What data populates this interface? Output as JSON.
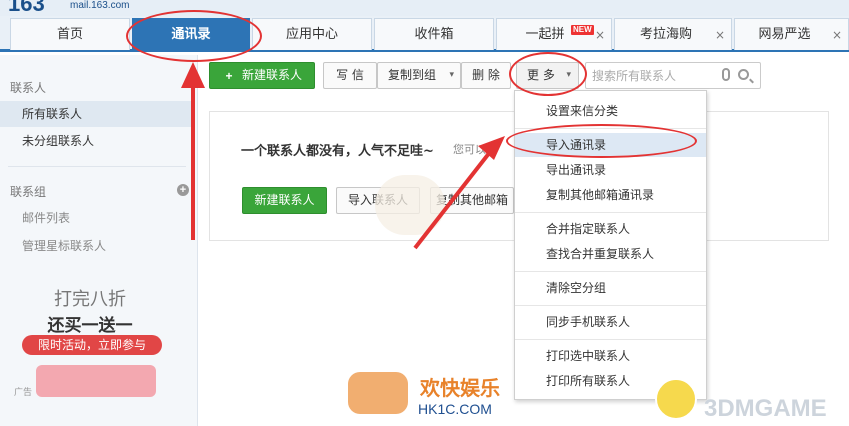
{
  "logo": {
    "number": "163",
    "domain": "mail.163.com"
  },
  "tabs": [
    {
      "label": "首页"
    },
    {
      "label": "通讯录"
    },
    {
      "label": "应用中心"
    },
    {
      "label": "收件箱"
    },
    {
      "label": "一起拼",
      "badge": "NEW"
    },
    {
      "label": "考拉海购"
    },
    {
      "label": "网易严选"
    }
  ],
  "close_glyph": "×",
  "sidebar": {
    "contacts_header": "联系人",
    "items": [
      "所有联系人",
      "未分组联系人"
    ],
    "groups_header": "联系组",
    "group_items": [
      "邮件列表",
      "管理星标联系人"
    ]
  },
  "ad": {
    "line1": "打完八折",
    "line2": "还买一送一",
    "line3": "限时活动，立即参与",
    "tag": "广告"
  },
  "toolbar": {
    "new_contact": "新建联系人",
    "write": "写 信",
    "copy_to_group": "复制到组",
    "delete": "删 除",
    "more": "更 多",
    "search_placeholder": "搜索所有联系人"
  },
  "empty_state": {
    "message": "一个联系人都没有，人气不足哇~",
    "hint": "您可以：",
    "new_contact": "新建联系人",
    "import": "导入联系人",
    "copy_other": "复制其他邮箱"
  },
  "menu": {
    "items": [
      "设置来信分类",
      "导入通讯录",
      "导出通讯录",
      "复制其他邮箱通讯录",
      "合并指定联系人",
      "查找合并重复联系人",
      "清除空分组",
      "同步手机联系人",
      "打印选中联系人",
      "打印所有联系人"
    ]
  },
  "watermarks": {
    "hk_cn": "欢快娱乐",
    "hk_en": "HK1C.COM",
    "game": "3DMGAME"
  },
  "colors": {
    "accent": "#2d74b5",
    "green": "#3aa53a",
    "annotation": "#e33333"
  }
}
